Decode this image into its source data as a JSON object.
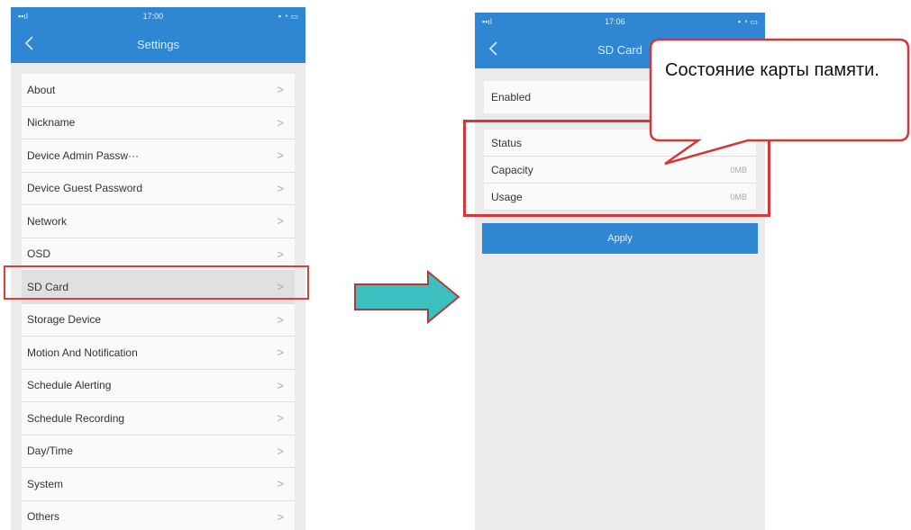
{
  "left_screen": {
    "status_time": "17:00",
    "title": "Settings",
    "items": [
      {
        "label": "About",
        "chevron": ">"
      },
      {
        "label": "Nickname",
        "chevron": ">"
      },
      {
        "label": "Device Admin Passw···",
        "chevron": ">"
      },
      {
        "label": "Device Guest Password",
        "chevron": ">"
      },
      {
        "label": "Network",
        "chevron": ">"
      },
      {
        "label": "OSD",
        "chevron": ">"
      },
      {
        "label": "SD Card",
        "chevron": ">",
        "selected": true
      },
      {
        "label": "Storage Device",
        "chevron": ">"
      },
      {
        "label": "Motion And Notification",
        "chevron": ">"
      },
      {
        "label": "Schedule Alerting",
        "chevron": ">"
      },
      {
        "label": "Schedule Recording",
        "chevron": ">"
      },
      {
        "label": "Day/Time",
        "chevron": ">"
      },
      {
        "label": "System",
        "chevron": ">"
      },
      {
        "label": "Others",
        "chevron": ">"
      }
    ]
  },
  "right_screen": {
    "status_time": "17:06",
    "title": "SD Card",
    "enabled_label": "Enabled",
    "info_rows": [
      {
        "label": "Status",
        "value": ""
      },
      {
        "label": "Capacity",
        "value": "0MB"
      },
      {
        "label": "Usage",
        "value": "0MB"
      }
    ],
    "apply_label": "Apply"
  },
  "callout": {
    "text": "Состояние карты памяти."
  },
  "colors": {
    "nav_blue": "#2f86d3",
    "highlight_red": "#e33a3a",
    "arrow_teal": "#3bbfbf"
  }
}
